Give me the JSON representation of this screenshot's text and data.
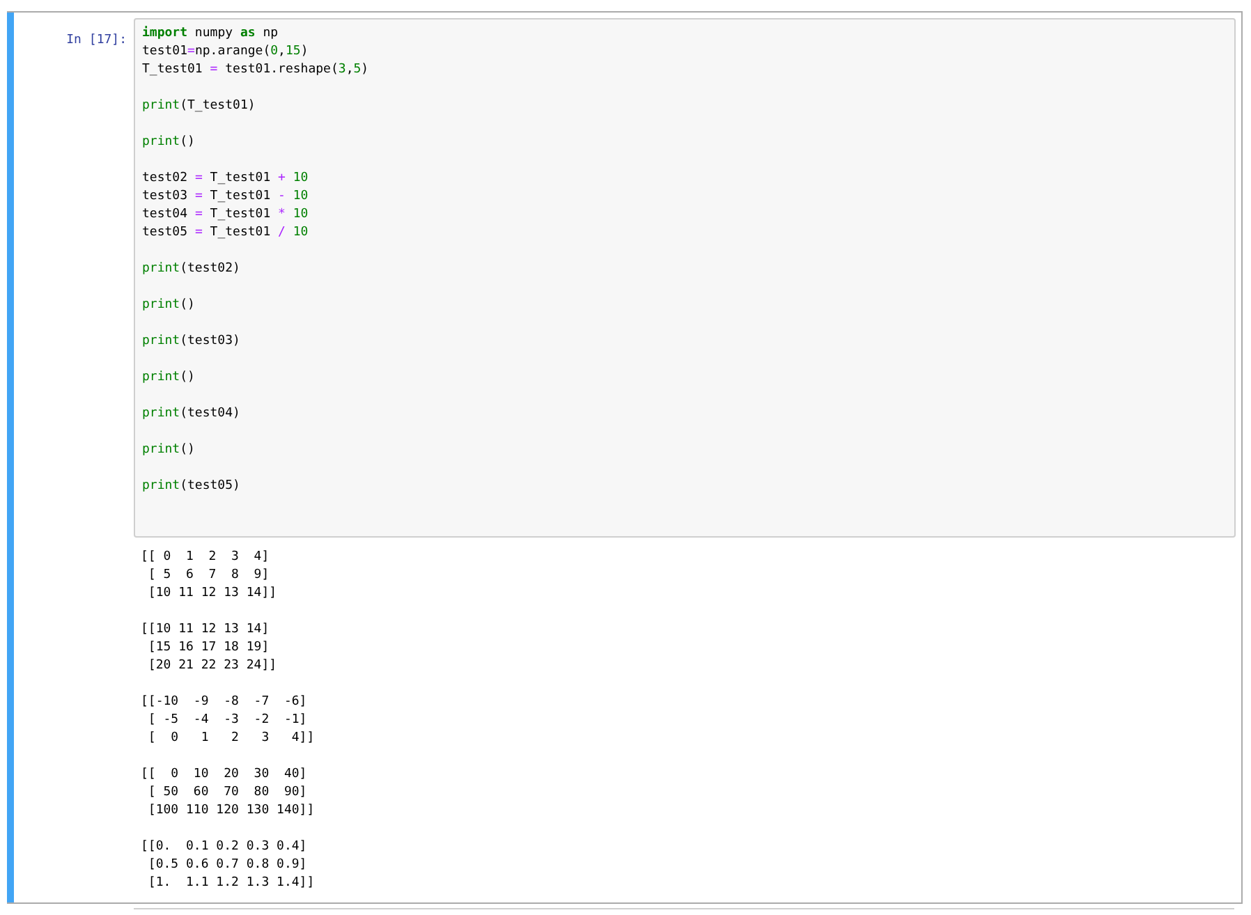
{
  "cell": {
    "prompt": "In [17]:",
    "code_blocks": [
      [
        [
          {
            "text": "import",
            "kind": "kw"
          },
          {
            "text": " numpy ",
            "kind": "name"
          },
          {
            "text": "as",
            "kind": "kw"
          },
          {
            "text": " np",
            "kind": "name"
          }
        ],
        [
          {
            "text": "test01",
            "kind": "name"
          },
          {
            "text": "=",
            "kind": "op"
          },
          {
            "text": "np.arange(",
            "kind": "name"
          },
          {
            "text": "0",
            "kind": "num"
          },
          {
            "text": ",",
            "kind": "name"
          },
          {
            "text": "15",
            "kind": "num"
          },
          {
            "text": ")",
            "kind": "name"
          }
        ],
        [
          {
            "text": "T_test01 ",
            "kind": "name"
          },
          {
            "text": "=",
            "kind": "op"
          },
          {
            "text": " test01.reshape(",
            "kind": "name"
          },
          {
            "text": "3",
            "kind": "num"
          },
          {
            "text": ",",
            "kind": "name"
          },
          {
            "text": "5",
            "kind": "num"
          },
          {
            "text": ")",
            "kind": "name"
          }
        ]
      ],
      [
        [
          {
            "text": "print",
            "kind": "builtin"
          },
          {
            "text": "(T_test01)",
            "kind": "name"
          }
        ]
      ],
      [
        [
          {
            "text": "print",
            "kind": "builtin"
          },
          {
            "text": "()",
            "kind": "name"
          }
        ]
      ],
      [
        [
          {
            "text": "test02 ",
            "kind": "name"
          },
          {
            "text": "=",
            "kind": "op"
          },
          {
            "text": " T_test01 ",
            "kind": "name"
          },
          {
            "text": "+",
            "kind": "op"
          },
          {
            "text": " 10",
            "kind": "num"
          }
        ],
        [
          {
            "text": "test03 ",
            "kind": "name"
          },
          {
            "text": "=",
            "kind": "op"
          },
          {
            "text": " T_test01 ",
            "kind": "name"
          },
          {
            "text": "-",
            "kind": "op"
          },
          {
            "text": " 10",
            "kind": "num"
          }
        ],
        [
          {
            "text": "test04 ",
            "kind": "name"
          },
          {
            "text": "=",
            "kind": "op"
          },
          {
            "text": " T_test01 ",
            "kind": "name"
          },
          {
            "text": "*",
            "kind": "op"
          },
          {
            "text": " 10",
            "kind": "num"
          }
        ],
        [
          {
            "text": "test05 ",
            "kind": "name"
          },
          {
            "text": "=",
            "kind": "op"
          },
          {
            "text": " T_test01 ",
            "kind": "name"
          },
          {
            "text": "/",
            "kind": "op"
          },
          {
            "text": " 10",
            "kind": "num"
          }
        ]
      ],
      [
        [
          {
            "text": "print",
            "kind": "builtin"
          },
          {
            "text": "(test02)",
            "kind": "name"
          }
        ]
      ],
      [
        [
          {
            "text": "print",
            "kind": "builtin"
          },
          {
            "text": "()",
            "kind": "name"
          }
        ]
      ],
      [
        [
          {
            "text": "print",
            "kind": "builtin"
          },
          {
            "text": "(test03)",
            "kind": "name"
          }
        ]
      ],
      [
        [
          {
            "text": "print",
            "kind": "builtin"
          },
          {
            "text": "()",
            "kind": "name"
          }
        ]
      ],
      [
        [
          {
            "text": "print",
            "kind": "builtin"
          },
          {
            "text": "(test04)",
            "kind": "name"
          }
        ]
      ],
      [
        [
          {
            "text": "print",
            "kind": "builtin"
          },
          {
            "text": "()",
            "kind": "name"
          }
        ]
      ],
      [
        [
          {
            "text": "print",
            "kind": "builtin"
          },
          {
            "text": "(test05)",
            "kind": "name"
          }
        ]
      ]
    ],
    "output_blocks": [
      [
        "[[ 0  1  2  3  4]",
        " [ 5  6  7  8  9]",
        " [10 11 12 13 14]]"
      ],
      [
        "[[10 11 12 13 14]",
        " [15 16 17 18 19]",
        " [20 21 22 23 24]]"
      ],
      [
        "[[-10  -9  -8  -7  -6]",
        " [ -5  -4  -3  -2  -1]",
        " [  0   1   2   3   4]]"
      ],
      [
        "[[  0  10  20  30  40]",
        " [ 50  60  70  80  90]",
        " [100 110 120 130 140]]"
      ],
      [
        "[[0.  0.1 0.2 0.3 0.4]",
        " [0.5 0.6 0.7 0.8 0.9]",
        " [1.  1.1 1.2 1.3 1.4]]"
      ]
    ]
  }
}
